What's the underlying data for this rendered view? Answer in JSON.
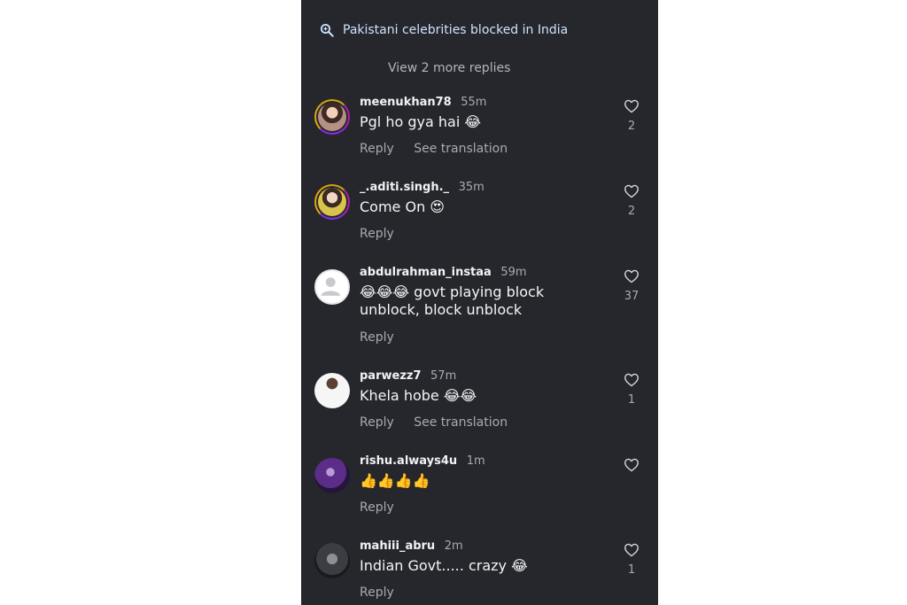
{
  "search": {
    "text": "Pakistani celebrities blocked in India"
  },
  "thread": {
    "view_more": "View 2 more replies"
  },
  "comments": [
    {
      "username": "meenukhan78",
      "time": "55m",
      "text": "Pgl ho gya hai 😂",
      "reply": "Reply",
      "translation": "See translation",
      "likes": "2",
      "avatar": "story-ring-avatar"
    },
    {
      "username": "_.aditi.singh._",
      "time": "35m",
      "text": "Come On 😍",
      "reply": "Reply",
      "likes": "2",
      "avatar": "story-ring-avatar"
    },
    {
      "username": "abdulrahman_instaa",
      "time": "59m",
      "text": "😂😂😂 govt playing block unblock, block unblock",
      "reply": "Reply",
      "likes": "37",
      "avatar": "default-avatar"
    },
    {
      "username": "parwezz7",
      "time": "57m",
      "text": "Khela hobe 😂😂",
      "reply": "Reply",
      "translation": "See translation",
      "likes": "1",
      "avatar": "photo-avatar"
    },
    {
      "username": "rishu.always4u",
      "time": "1m",
      "text": "👍👍👍👍",
      "reply": "Reply",
      "avatar": "photo-avatar"
    },
    {
      "username": "mahiii_abru",
      "time": "2m",
      "text": "Indian Govt..... crazy 😂",
      "reply": "Reply",
      "likes": "1",
      "avatar": "photo-avatar"
    }
  ],
  "colors": {
    "panel_bg": "#25272c",
    "text_primary": "#f1f2f4",
    "text_secondary": "#a7aab0",
    "search_text": "#cfe3ff"
  }
}
